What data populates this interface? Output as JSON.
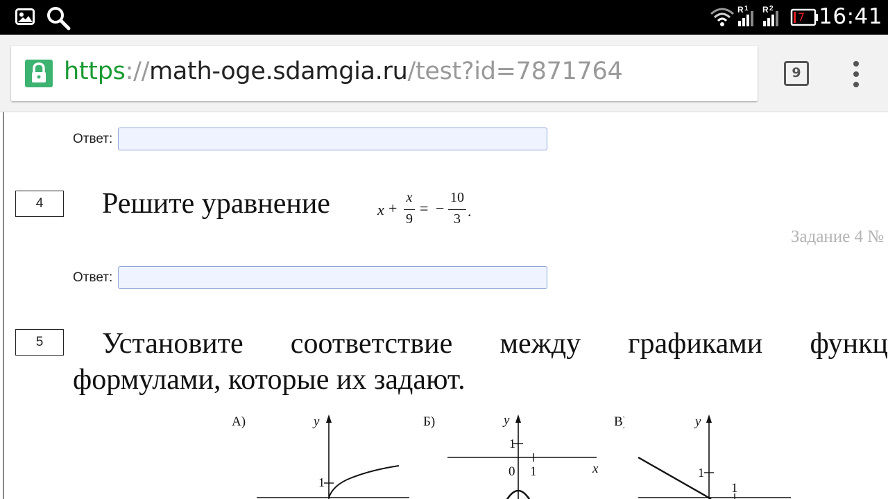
{
  "status_bar": {
    "left_icons": [
      "image-icon",
      "search-icon"
    ],
    "right_icons": [
      "wifi-icon",
      "signal-sim1-icon",
      "signal-sim2-icon",
      "battery-icon"
    ],
    "sim1_label": "R",
    "sim1_index": "1",
    "sim2_label": "R",
    "sim2_index": "2",
    "battery_level": "7",
    "time": "16:41"
  },
  "browser": {
    "url_scheme": "https",
    "url_separator": "://",
    "url_host": "math-oge.sdamgia.ru",
    "url_path": "/test?id=7871764",
    "tab_count": "9",
    "accent_color": "#1a9a33"
  },
  "content": {
    "answer_label": "Ответ:",
    "task4": {
      "number": "4",
      "text": "Решите уравнение",
      "eq_x": "x",
      "eq_plus": "+",
      "eq_frac_num": "x",
      "eq_frac_den": "9",
      "eq_equals": "=",
      "eq_minus": "−",
      "eq_rhs_num": "10",
      "eq_rhs_den": "3",
      "eq_period": ".",
      "hint": "Задание 4 №"
    },
    "task5": {
      "number": "5",
      "text_line1": "Установите соответствие между графиками функц",
      "text_line2": "формулами, которые их задают."
    },
    "graphs": {
      "a": {
        "label": "А)",
        "y_axis": "y",
        "tick": "1"
      },
      "b": {
        "label": "Б)",
        "y_axis": "y",
        "x_axis": "x",
        "tick_y": "1",
        "origin": "0",
        "tick_x": "1"
      },
      "c": {
        "label": "В)",
        "y_axis": "y",
        "tick_y": "1",
        "tick_x": "1"
      }
    }
  }
}
